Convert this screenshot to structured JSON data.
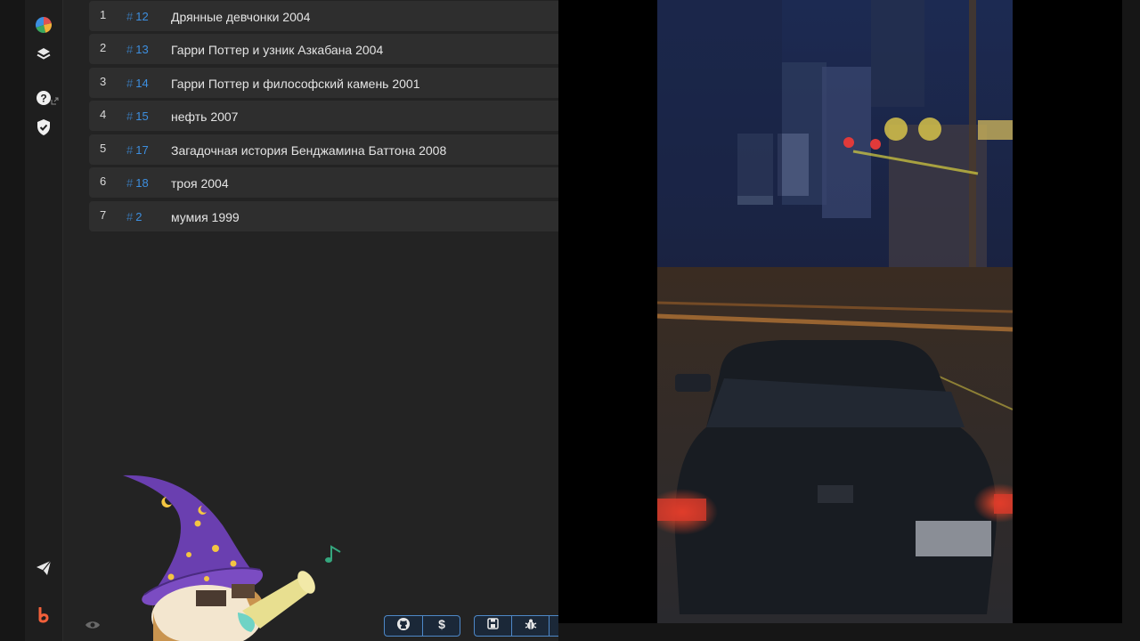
{
  "list": {
    "rows": [
      {
        "num": "1",
        "id": "12",
        "title": "Дрянные девчонки 2004"
      },
      {
        "num": "2",
        "id": "13",
        "title": "Гарри Поттер и узник Азкабана 2004"
      },
      {
        "num": "3",
        "id": "14",
        "title": "Гарри Поттер и философский камень 2001"
      },
      {
        "num": "4",
        "id": "15",
        "title": "нефть 2007"
      },
      {
        "num": "5",
        "id": "17",
        "title": "Загадочная история Бенджамина Баттона 2008"
      },
      {
        "num": "6",
        "id": "18",
        "title": "троя 2004"
      },
      {
        "num": "7",
        "id": "2",
        "title": "мумия 1999"
      }
    ],
    "hash_symbol": "#"
  },
  "sidebar": {
    "icons": [
      "pie-chart-icon",
      "layers-icon",
      "help-icon",
      "shield-check-icon",
      "send-icon",
      "brand-b-icon"
    ]
  },
  "toolbar": {
    "buttons": [
      "github-icon",
      "dollar-icon",
      "save-icon",
      "bug-icon"
    ]
  },
  "colors": {
    "accent": "#3d8fe0",
    "row_bg": "#2e2e2e",
    "panel_bg": "#232323",
    "brand_b": "#f2603a"
  }
}
